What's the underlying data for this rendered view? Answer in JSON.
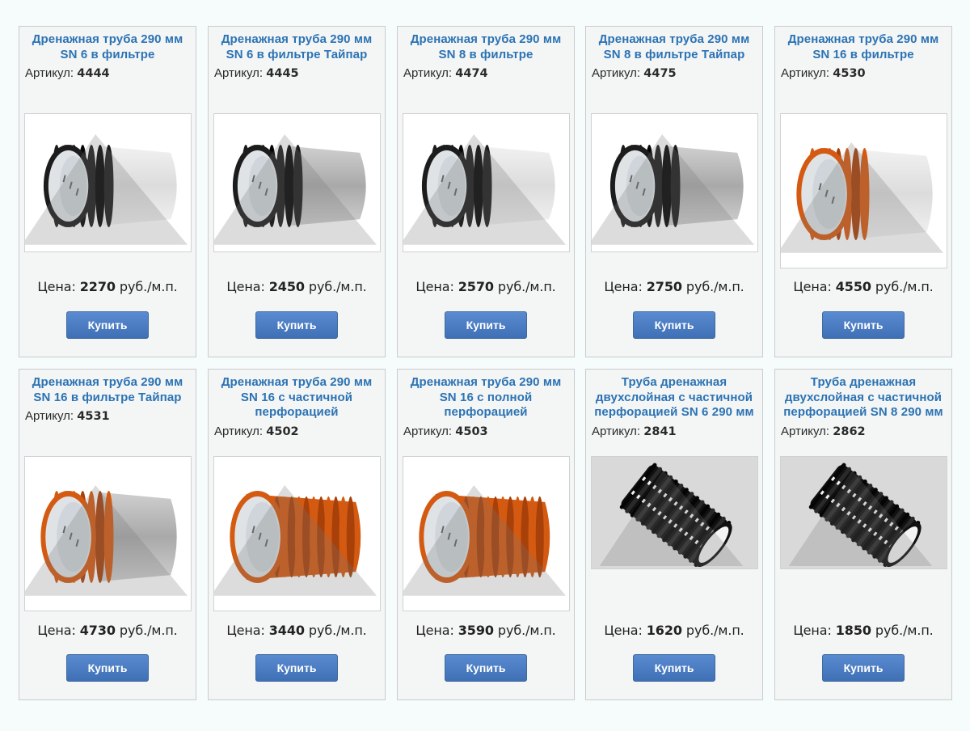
{
  "labels": {
    "sku_prefix": "Артикул:",
    "price_prefix": "Цена:",
    "price_unit": "руб./м.п.",
    "buy": "Купить"
  },
  "products": [
    {
      "title": "Дренажная труба 290 мм SN 6 в фильтре",
      "sku": "4444",
      "price": "2270",
      "pipe": "black",
      "filter": "white",
      "image": "drainage-pipe-black-filter"
    },
    {
      "title": "Дренажная труба 290 мм SN 6 в фильтре Тайпар",
      "sku": "4445",
      "price": "2450",
      "pipe": "black",
      "filter": "gray",
      "image": "drainage-pipe-black-typar-filter"
    },
    {
      "title": "Дренажная труба 290 мм SN 8 в фильтре",
      "sku": "4474",
      "price": "2570",
      "pipe": "black",
      "filter": "white",
      "image": "drainage-pipe-black-filter"
    },
    {
      "title": "Дренажная труба 290 мм SN 8 в фильтре Тайпар",
      "sku": "4475",
      "price": "2750",
      "pipe": "black",
      "filter": "gray",
      "image": "drainage-pipe-black-typar-filter"
    },
    {
      "title": "Дренажная труба 290 мм SN 16 в фильтре",
      "sku": "4530",
      "price": "4550",
      "pipe": "orange",
      "filter": "white",
      "image": "drainage-pipe-orange-filter"
    },
    {
      "title": "Дренажная труба 290 мм SN 16 в фильтре Тайпар",
      "sku": "4531",
      "price": "4730",
      "pipe": "orange",
      "filter": "gray",
      "image": "drainage-pipe-orange-typar-filter"
    },
    {
      "title": "Дренажная труба 290 мм SN 16 с частичной перфорацией",
      "sku": "4502",
      "price": "3440",
      "pipe": "orange",
      "filter": "none",
      "image": "drainage-pipe-orange"
    },
    {
      "title": "Дренажная труба 290 мм SN 16 с полной перфорацией",
      "sku": "4503",
      "price": "3590",
      "pipe": "orange",
      "filter": "none",
      "image": "drainage-pipe-orange"
    },
    {
      "title": "Труба дренажная двухслойная с частичной перфорацией SN 6 290 мм",
      "sku": "2841",
      "price": "1620",
      "pipe": "black-perforated",
      "filter": "none",
      "image": "perforated-black-pipe"
    },
    {
      "title": "Труба дренажная двухслойная с частичной перфорацией SN 8 290 мм",
      "sku": "2862",
      "price": "1850",
      "pipe": "black-perforated",
      "filter": "none",
      "image": "perforated-black-pipe"
    }
  ],
  "colors": {
    "title": "#2b73b4",
    "button": "#4a7cc2",
    "pipe_black": "#1a1a1a",
    "pipe_orange": "#d45a12",
    "card_bg": "#f4f5f5",
    "card_border": "#c9cccd"
  }
}
